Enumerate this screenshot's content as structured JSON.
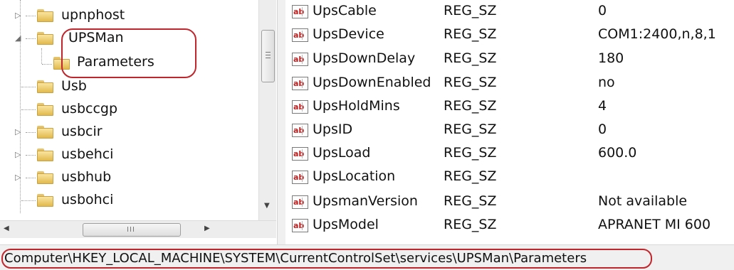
{
  "tree": {
    "items": [
      {
        "label": "upnphost",
        "expander": "▷"
      },
      {
        "label": "UPSMan",
        "expander": "◢"
      },
      {
        "label": "Parameters",
        "expander": ""
      },
      {
        "label": "Usb",
        "expander": ""
      },
      {
        "label": "usbccgp",
        "expander": ""
      },
      {
        "label": "usbcir",
        "expander": "▷"
      },
      {
        "label": "usbehci",
        "expander": "▷"
      },
      {
        "label": "usbhub",
        "expander": "▷"
      },
      {
        "label": "usbohci",
        "expander": ""
      }
    ],
    "hscroll_grip": "III"
  },
  "values": {
    "rows": [
      {
        "name": "UpsCable",
        "type": "REG_SZ",
        "data": "0"
      },
      {
        "name": "UpsDevice",
        "type": "REG_SZ",
        "data": "COM1:2400,n,8,1"
      },
      {
        "name": "UpsDownDelay",
        "type": "REG_SZ",
        "data": "180"
      },
      {
        "name": "UpsDownEnabled",
        "type": "REG_SZ",
        "data": "no"
      },
      {
        "name": "UpsHoldMins",
        "type": "REG_SZ",
        "data": "4"
      },
      {
        "name": "UpsID",
        "type": "REG_SZ",
        "data": "0"
      },
      {
        "name": "UpsLoad",
        "type": "REG_SZ",
        "data": "600.0"
      },
      {
        "name": "UpsLocation",
        "type": "REG_SZ",
        "data": ""
      },
      {
        "name": "UpsmanVersion",
        "type": "REG_SZ",
        "data": "Not available"
      },
      {
        "name": "UpsModel",
        "type": "REG_SZ",
        "data": "APRANET MI 600"
      }
    ],
    "icon_text": "ab"
  },
  "status_bar": {
    "path": "Computer\\HKEY_LOCAL_MACHINE\\SYSTEM\\CurrentControlSet\\services\\UPSMan\\Parameters"
  },
  "colors": {
    "highlight": "#c0262c",
    "folder": "#e2ba4d"
  }
}
